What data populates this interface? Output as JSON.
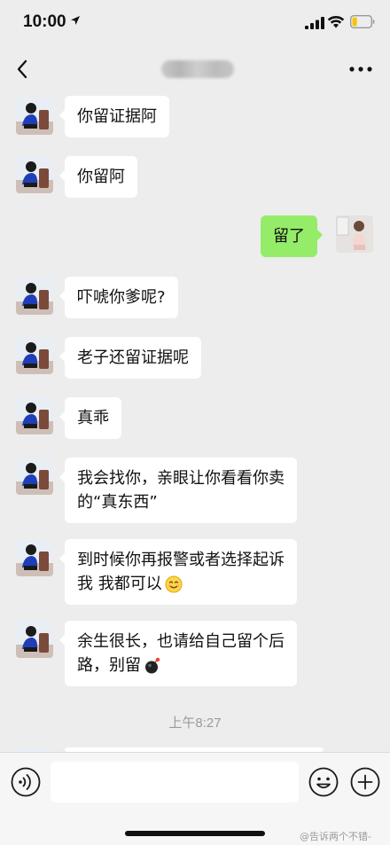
{
  "status_bar": {
    "time": "10:00",
    "location_icon": "location-arrow-icon",
    "signal_icon": "cellular-signal-icon",
    "wifi_icon": "wifi-icon",
    "battery_icon": "battery-low-icon",
    "battery_color": "#f5c400"
  },
  "header": {
    "back_icon": "chevron-left-icon",
    "more_icon": "more-dots-icon"
  },
  "messages": [
    {
      "side": "left",
      "text": "你留证据阿"
    },
    {
      "side": "left",
      "text": "你留阿"
    },
    {
      "side": "right",
      "text": "留了"
    },
    {
      "side": "left",
      "text": "吓唬你爹呢?"
    },
    {
      "side": "left",
      "text": "老子还留证据呢"
    },
    {
      "side": "left",
      "text": "真乖"
    },
    {
      "side": "left",
      "line1": "我会找你，亲眼让你看看你卖",
      "line2": "的“真东西”"
    },
    {
      "side": "left",
      "line1": "到时候你再报警或者选择起诉",
      "line2": "我 我都可以",
      "emoji": "smile-emoji-icon"
    },
    {
      "side": "left",
      "line1": "余生很长，也请给自己留个后",
      "line2": "路，别留",
      "emoji": "bomb-emoji-icon"
    }
  ],
  "timestamp": "上午8:27",
  "input_bar": {
    "voice_icon": "voice-icon",
    "emoji_icon": "smiley-icon",
    "plus_icon": "plus-circle-icon",
    "placeholder": ""
  },
  "colors": {
    "background": "#ededed",
    "incoming_bubble": "#ffffff",
    "outgoing_bubble": "#95ec69"
  },
  "watermark": "@告诉两个不错-"
}
